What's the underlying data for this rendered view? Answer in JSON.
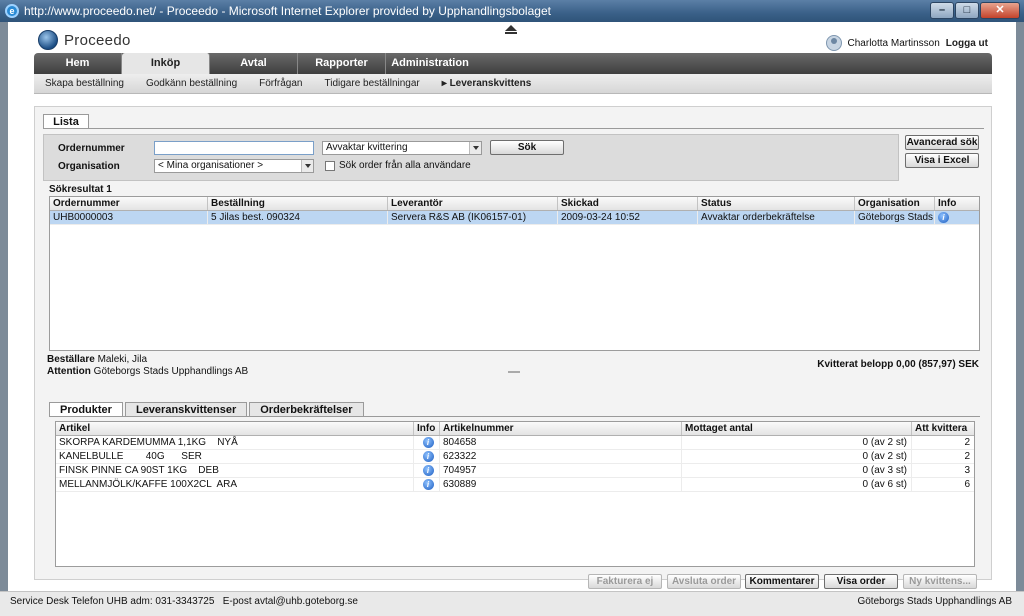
{
  "window": {
    "title": "http://www.proceedo.net/ - Proceedo - Microsoft Internet Explorer provided by Upphandlingsbolaget"
  },
  "app": {
    "logo": "Proceedo",
    "user": "Charlotta Martinsson",
    "logout": "Logga ut"
  },
  "nav": {
    "tabs": [
      "Hem",
      "Inköp",
      "Avtal",
      "Rapporter",
      "Administration"
    ],
    "active": 1
  },
  "subnav": {
    "items": [
      "Skapa beställning",
      "Godkänn beställning",
      "Förfrågan",
      "Tidigare beställningar",
      "Leveranskvittens"
    ],
    "current": "Leveranskvittens"
  },
  "lista": {
    "tab": "Lista",
    "ordernummer_label": "Ordernummer",
    "ordernummer_value": "",
    "organisation_label": "Organisation",
    "organisation_value": "< Mina organisationer >",
    "status_value": "Avvaktar kvittering",
    "sok_label": "Sök",
    "alla_label": "Sök order från alla användare",
    "avancerad_label": "Avancerad sök",
    "excel_label": "Visa i Excel",
    "results_label": "Sökresultat 1",
    "columns": [
      "Ordernummer",
      "Beställning",
      "Leverantör",
      "Skickad",
      "Status",
      "Organisation",
      "Info"
    ],
    "rows": [
      [
        "UHB0000003",
        "5 Jilas best. 090324",
        "Servera R&S AB (IK06157-01)",
        "2009-03-24 10:52",
        "Avvaktar orderbekräftelse",
        "Göteborgs Stads ..."
      ]
    ]
  },
  "details": {
    "bestallare_label": "Beställare",
    "bestallare_value": "Maleki, Jila",
    "attention_label": "Attention",
    "attention_value": "Göteborgs Stads Upphandlings AB",
    "kvitterat": "Kvitterat belopp 0,00 (857,97) SEK"
  },
  "products": {
    "tabs": [
      "Produkter",
      "Leveranskvittenser",
      "Orderbekräftelser"
    ],
    "columns": [
      "Artikel",
      "Info",
      "Artikelnummer",
      "Mottaget antal",
      "Att kvittera"
    ],
    "rows": [
      [
        "SKORPA KARDEMUMMA 1,1KG    NYÅ",
        "804658",
        "0 (av 2 st)",
        "2"
      ],
      [
        "KANELBULLE        40G      SER",
        "623322",
        "0 (av 2 st)",
        "2"
      ],
      [
        "FINSK PINNE CA 90ST 1KG    DEB",
        "704957",
        "0 (av 3 st)",
        "3"
      ],
      [
        "MELLANMJÖLK/KAFFE 100X2CL  ARA",
        "630889",
        "0 (av 6 st)",
        "6"
      ]
    ]
  },
  "actions": {
    "fakturera": "Fakturera ej",
    "avsluta": "Avsluta order",
    "kommentarer": "Kommentarer",
    "visa_order": "Visa order",
    "ny_kvittens": "Ny kvittens..."
  },
  "status": {
    "left": "Service Desk Telefon UHB adm: 031-3343725   E-post avtal@uhb.goteborg.se",
    "right": "Göteborgs Stads Upphandlings AB"
  }
}
